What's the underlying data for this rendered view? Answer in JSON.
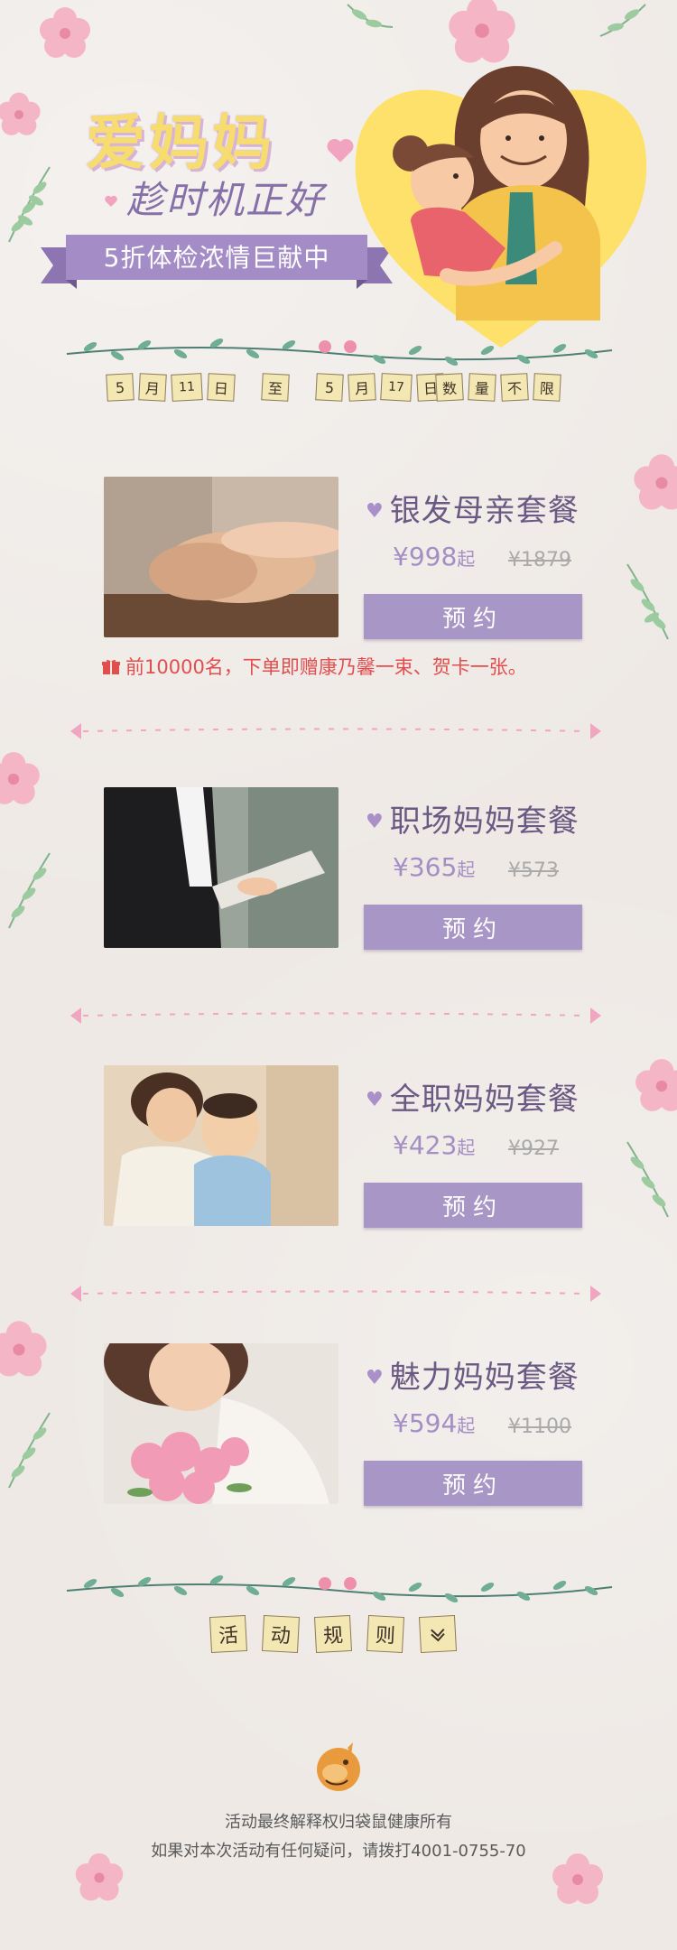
{
  "hero": {
    "title": "爱妈妈",
    "subtitle": "趁时机正好",
    "ribbon_text": "5折体检浓情巨献中"
  },
  "date_tags": [
    "5",
    "月",
    "11",
    "日",
    "至",
    "5",
    "月",
    "17",
    "日"
  ],
  "quantity_tags": [
    "数",
    "量",
    "不",
    "限"
  ],
  "packages": [
    {
      "name": "银发母亲套餐",
      "price": "¥998",
      "price_suffix": "起",
      "old_price": "¥1879",
      "button": "预约",
      "photo": "elderly-hands-photo"
    },
    {
      "name": "职场妈妈套餐",
      "price": "¥365",
      "price_suffix": "起",
      "old_price": "¥573",
      "button": "预约",
      "photo": "businesswoman-reading-photo"
    },
    {
      "name": "全职妈妈套餐",
      "price": "¥423",
      "price_suffix": "起",
      "old_price": "¥927",
      "button": "预约",
      "photo": "mother-and-baby-photo"
    },
    {
      "name": "魅力妈妈套餐",
      "price": "¥594",
      "price_suffix": "起",
      "old_price": "¥1100",
      "button": "预约",
      "photo": "woman-with-flowers-photo"
    }
  ],
  "gift_note": "前10000名，下单即赠康乃馨一束、贺卡一张。",
  "rules_tags": [
    "活",
    "动",
    "规",
    "则"
  ],
  "rules_toggle_icon": "chevron-down-icon",
  "footer": {
    "line1": "活动最终解释权归袋鼠健康所有",
    "line2": "如果对本次活动有任何疑问，请拨打4001-0755-70"
  },
  "colors": {
    "background": "#eee9e5",
    "accent_purple": "#a897c6",
    "title_yellow": "#f7dc6f",
    "gift_red": "#e24e4e",
    "flower_pink": "#f4b6c6",
    "leaf_green": "#7fb48a"
  }
}
